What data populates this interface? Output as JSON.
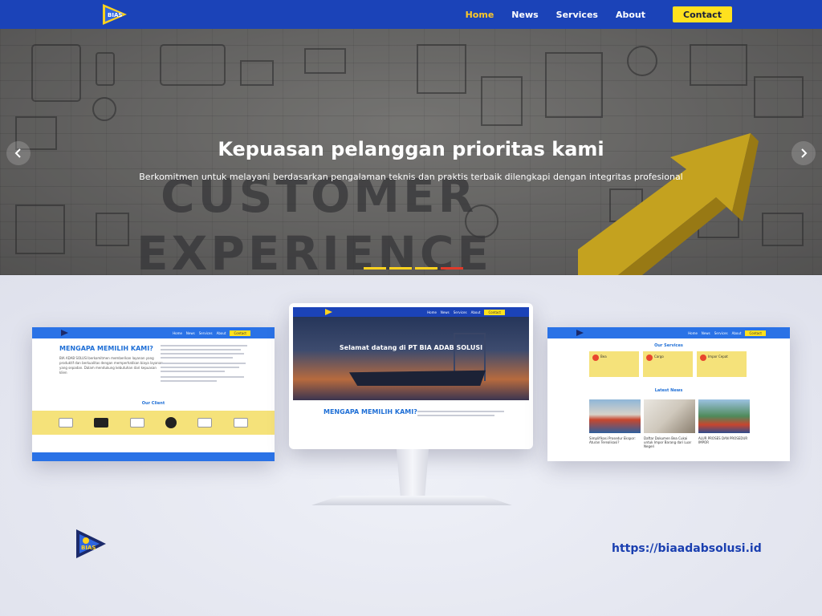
{
  "nav": {
    "logo_icon": "bias-logo-icon",
    "items": [
      {
        "label": "Home",
        "active": true
      },
      {
        "label": "News",
        "active": false
      },
      {
        "label": "Services",
        "active": false
      },
      {
        "label": "About",
        "active": false
      }
    ],
    "contact_label": "Contact",
    "colors": {
      "bar": "#1b43b8",
      "active": "#ffc928",
      "contact_bg": "#ffe11e"
    }
  },
  "hero": {
    "title": "Kepuasan pelanggan prioritas kami",
    "subtitle": "Berkomitmen untuk melayani berdasarkan pengalaman teknis dan praktis terbaik dilengkapi dengan integritas profesional",
    "prev_icon": "chevron-left-icon",
    "next_icon": "chevron-right-icon",
    "slides": 4,
    "active_slide": 1
  },
  "mockups": {
    "left": {
      "nav": [
        "Home",
        "News",
        "Services",
        "About"
      ],
      "contact": "Contact",
      "heading": "MENGAPA MEMILIH KAMI?",
      "paragraph": "BIA ADAB SOLUSI berkomitmen memberikan layanan yang produktif dan berkualitas dengan memperhatikan biaya layanan yang sepadan. Dalam mendukung kebutuhan dari kepuasan klien",
      "section": "Our Client"
    },
    "center": {
      "nav": [
        "Home",
        "News",
        "Services",
        "About"
      ],
      "contact": "Contact",
      "hero_title": "Selamat datang di PT BIA ADAB SOLUSI",
      "heading": "MENGAPA MEMILIH KAMI?"
    },
    "right": {
      "nav": [
        "Home",
        "News",
        "Services",
        "About"
      ],
      "contact": "Contact",
      "section_services": "Our Services",
      "services": [
        "Bea",
        "Cargo",
        "Impor Cepat"
      ],
      "section_news": "Latest News",
      "news": [
        "Simplifikasi Prosedur Ekspor: Aturan Terealisasi?",
        "Daftar Dokumen Bea Cukai untuk Impor Barang dari Luar Negeri",
        "ALUR PROSES DAN PROSEDUR IMPOR"
      ]
    }
  },
  "footer": {
    "logo_icon": "bias-logo-icon",
    "url": "https://biaadabsolusi.id"
  }
}
